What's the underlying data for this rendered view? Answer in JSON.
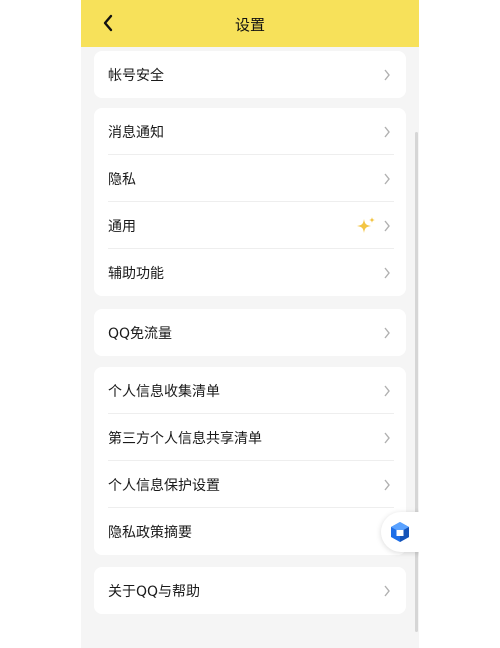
{
  "header": {
    "title": "设置",
    "background": "#f7e15a"
  },
  "groups": [
    {
      "items": [
        {
          "label": "帐号安全"
        }
      ]
    },
    {
      "items": [
        {
          "label": "消息通知"
        },
        {
          "label": "隐私"
        },
        {
          "label": "通用",
          "badge_icon": "sparkle-icon"
        },
        {
          "label": "辅助功能"
        }
      ]
    },
    {
      "items": [
        {
          "label": "QQ免流量"
        }
      ]
    },
    {
      "items": [
        {
          "label": "个人信息收集清单"
        },
        {
          "label": "第三方个人信息共享清单"
        },
        {
          "label": "个人信息保护设置"
        },
        {
          "label": "隐私政策摘要"
        }
      ]
    },
    {
      "items": [
        {
          "label": "关于QQ与帮助"
        }
      ]
    }
  ],
  "floating_button": {
    "icon": "cube-icon",
    "color": "#1e6fe8"
  }
}
